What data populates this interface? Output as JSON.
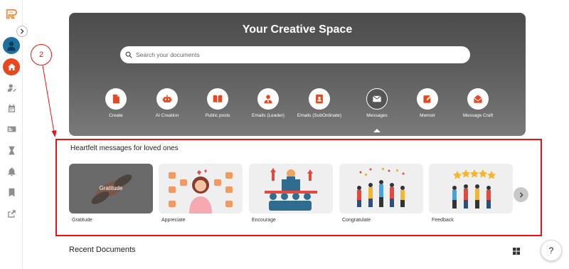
{
  "brand": {
    "accent": "#e8471f"
  },
  "annotation": {
    "number": "2",
    "color": "#e11111"
  },
  "hero": {
    "title": "Your Creative Space",
    "search_placeholder": "Search your documents",
    "categories": [
      {
        "label": "Create",
        "icon": "file-icon"
      },
      {
        "label": "AI Creation",
        "icon": "robot-icon"
      },
      {
        "label": "Public posts",
        "icon": "book-icon"
      },
      {
        "label": "Emails (Leader)",
        "icon": "leader-icon"
      },
      {
        "label": "Emails (SubOrdinate)",
        "icon": "contact-card-icon"
      },
      {
        "label": "Messages",
        "icon": "envelope-icon",
        "active": true
      },
      {
        "label": "Memoir",
        "icon": "pencil-square-icon"
      },
      {
        "label": "Message Craft",
        "icon": "open-envelope-icon"
      }
    ]
  },
  "section": {
    "title": "Heartfelt messages for loved ones",
    "cards": [
      {
        "label": "Gratitude",
        "overlay": "Gratitude"
      },
      {
        "label": "Appreciate"
      },
      {
        "label": "Encourage"
      },
      {
        "label": "Congratulate"
      },
      {
        "label": "Feedback"
      }
    ]
  },
  "recent": {
    "title": "Recent Documents"
  },
  "help": {
    "label": "?"
  }
}
